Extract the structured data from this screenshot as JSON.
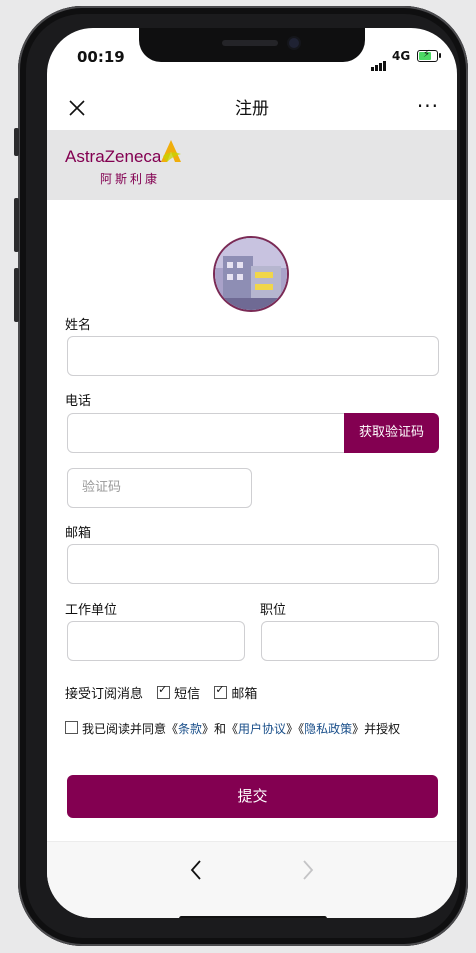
{
  "status": {
    "time": "00:19",
    "network": "4G"
  },
  "nav": {
    "title": "注册",
    "more": "···"
  },
  "brand": {
    "name": "AstraZeneca",
    "name_cn": "阿斯利康",
    "color": "#830051"
  },
  "form": {
    "name_label": "姓名",
    "phone_label": "电话",
    "get_code": "获取验证码",
    "code_placeholder": "验证码",
    "email_label": "邮箱",
    "company_label": "工作单位",
    "position_label": "职位",
    "subscribe_label": "接受订阅消息",
    "sms_label": "短信",
    "email_opt_label": "邮箱",
    "agree_prefix": "我已阅读并同意《",
    "terms": "条款",
    "agree_mid1": "》和《",
    "user_agreement": "用户协议",
    "agree_mid2": "》《",
    "privacy": "隐私政策",
    "agree_suffix": "》并授权",
    "submit": "提交"
  }
}
